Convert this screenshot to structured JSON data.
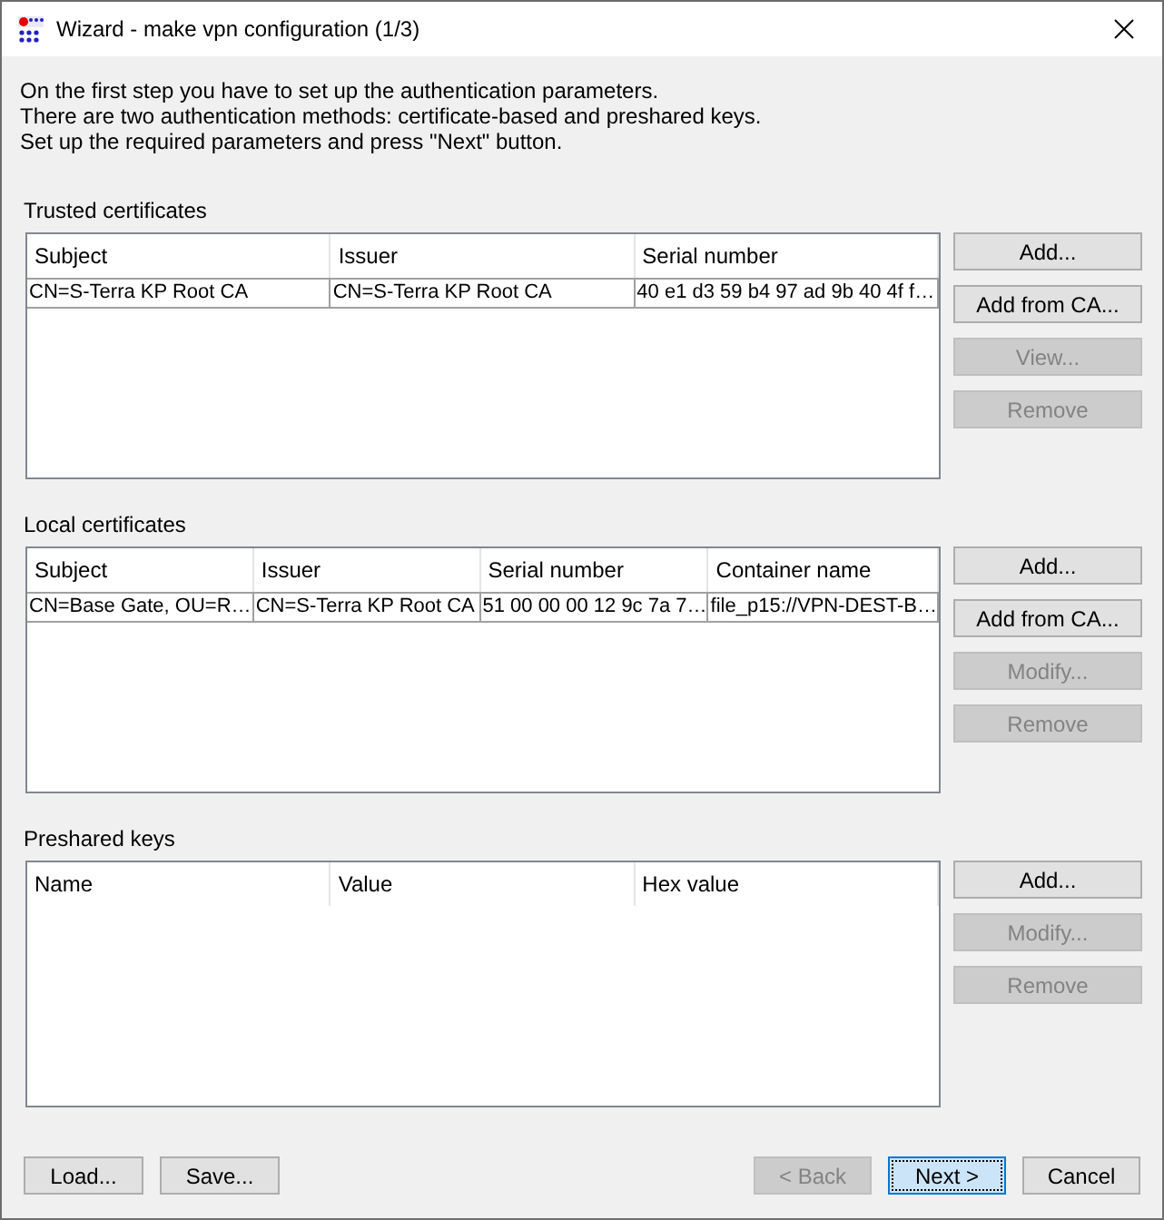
{
  "window": {
    "title": "Wizard - make vpn configuration (1/3)"
  },
  "intro": [
    "On the first step you have to set up the authentication parameters.",
    "There are two authentication methods: certificate-based and preshared keys.",
    "Set up the required parameters and press \"Next\" button."
  ],
  "sections": [
    {
      "label": "Trusted certificates",
      "columns": [
        "Subject",
        "Issuer",
        "Serial number"
      ],
      "rows": [
        [
          "CN=S-Terra KP Root CA",
          "CN=S-Terra KP Root CA",
          "40 e1 d3 59 b4 97 ad 9b 40 4f f…"
        ]
      ],
      "buttons": [
        {
          "label": "Add...",
          "disabled": false
        },
        {
          "label": "Add from CA...",
          "disabled": false
        },
        {
          "label": "View...",
          "disabled": true
        },
        {
          "label": "Remove",
          "disabled": true
        }
      ]
    },
    {
      "label": "Local certificates",
      "columns": [
        "Subject",
        "Issuer",
        "Serial number",
        "Container name"
      ],
      "rows": [
        [
          "CN=Base Gate, OU=R…",
          "CN=S-Terra KP Root CA",
          "51 00 00 00 12 9c 7a 7…",
          "file_p15://VPN-DEST-B…"
        ]
      ],
      "buttons": [
        {
          "label": "Add...",
          "disabled": false
        },
        {
          "label": "Add from CA...",
          "disabled": false
        },
        {
          "label": "Modify...",
          "disabled": true
        },
        {
          "label": "Remove",
          "disabled": true
        }
      ]
    },
    {
      "label": "Preshared keys",
      "columns": [
        "Name",
        "Value",
        "Hex value"
      ],
      "buttons": [
        {
          "label": "Add...",
          "disabled": false
        },
        {
          "label": "Modify...",
          "disabled": true
        },
        {
          "label": "Remove",
          "disabled": true
        }
      ]
    }
  ],
  "footer_left": [
    {
      "label": "Load...",
      "disabled": false,
      "default": false
    },
    {
      "label": "Save...",
      "disabled": false,
      "default": false
    }
  ],
  "footer_right": [
    {
      "label": "< Back",
      "disabled": true,
      "default": false
    },
    {
      "label": "Next >",
      "disabled": false,
      "default": true
    },
    {
      "label": "Cancel",
      "disabled": false,
      "default": false
    }
  ]
}
